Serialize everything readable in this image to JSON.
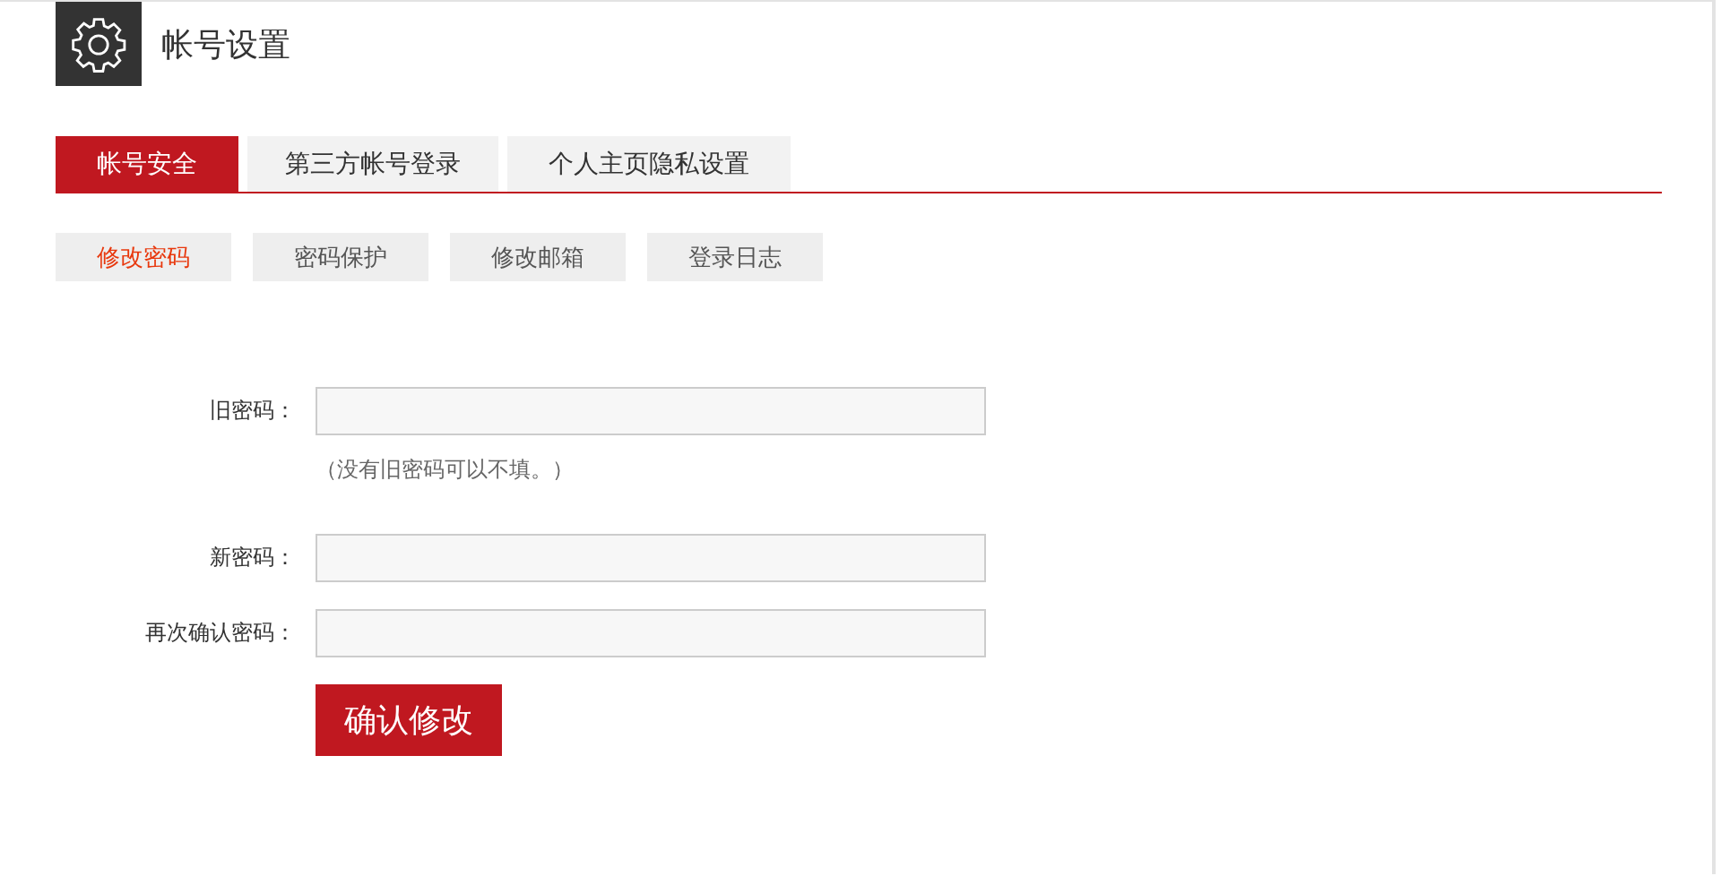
{
  "header": {
    "title": "帐号设置"
  },
  "tabs": [
    {
      "label": "帐号安全",
      "selected": true
    },
    {
      "label": "第三方帐号登录",
      "selected": false
    },
    {
      "label": "个人主页隐私设置",
      "selected": false
    }
  ],
  "subtabs": [
    {
      "label": "修改密码",
      "selected": true
    },
    {
      "label": "密码保护",
      "selected": false
    },
    {
      "label": "修改邮箱",
      "selected": false
    },
    {
      "label": "登录日志",
      "selected": false
    }
  ],
  "fields": [
    {
      "label": "旧密码：",
      "hint": "（没有旧密码可以不填。）"
    },
    {
      "label": "新密码："
    },
    {
      "label": "再次确认密码："
    }
  ],
  "submit": "确认修改"
}
